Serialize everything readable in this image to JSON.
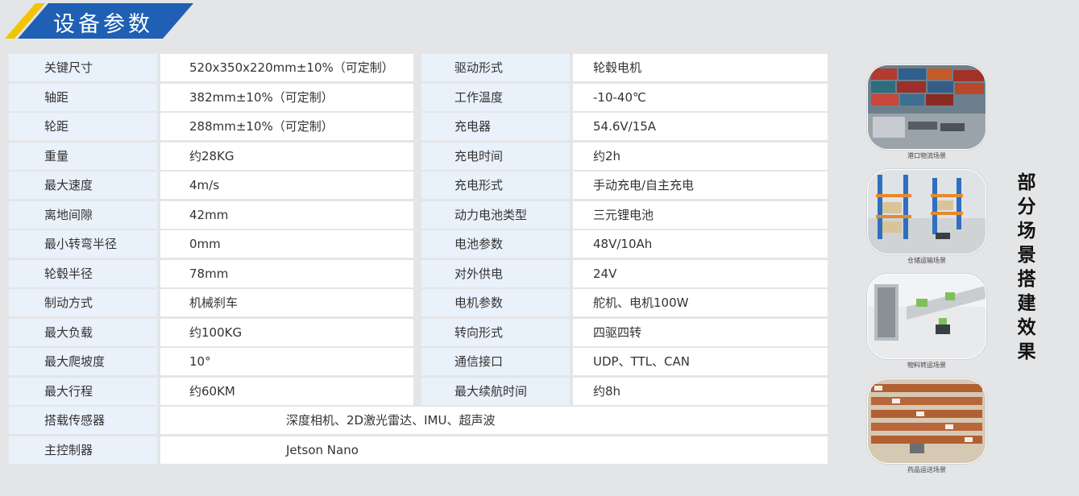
{
  "header": {
    "title": "设备参数"
  },
  "specs": [
    {
      "label1": "关键尺寸",
      "value1": "520x350x220mm±10%（可定制）",
      "label2": "驱动形式",
      "value2": "轮毂电机"
    },
    {
      "label1": "轴距",
      "value1": "382mm±10%（可定制）",
      "label2": "工作温度",
      "value2": "-10-40℃"
    },
    {
      "label1": "轮距",
      "value1": "288mm±10%（可定制）",
      "label2": "充电器",
      "value2": "54.6V/15A"
    },
    {
      "label1": "重量",
      "value1": "约28KG",
      "label2": "充电时间",
      "value2": "约2h"
    },
    {
      "label1": "最大速度",
      "value1": "4m/s",
      "label2": "充电形式",
      "value2": "手动充电/自主充电"
    },
    {
      "label1": "离地间隙",
      "value1": "42mm",
      "label2": "动力电池类型",
      "value2": "三元锂电池"
    },
    {
      "label1": "最小转弯半径",
      "value1": "0mm",
      "label2": "电池参数",
      "value2": "48V/10Ah"
    },
    {
      "label1": "轮毂半径",
      "value1": "78mm",
      "label2": "对外供电",
      "value2": "24V"
    },
    {
      "label1": "制动方式",
      "value1": "机械刹车",
      "label2": "电机参数",
      "value2": "舵机、电机100W"
    },
    {
      "label1": "最大负载",
      "value1": "约100KG",
      "label2": "转向形式",
      "value2": "四驱四转"
    },
    {
      "label1": "最大爬坡度",
      "value1": "10°",
      "label2": "通信接口",
      "value2": "UDP、TTL、CAN"
    },
    {
      "label1": "最大行程",
      "value1": "约60KM",
      "label2": "最大续航时间",
      "value2": "约8h"
    }
  ],
  "specs_wide": [
    {
      "label": "搭载传感器",
      "value": "深度相机、2D激光雷达、IMU、超声波"
    },
    {
      "label": "主控制器",
      "value": "Jetson Nano"
    }
  ],
  "scenes": [
    {
      "caption": "港口物流场景",
      "icon": "port-scene-image"
    },
    {
      "caption": "仓储运输场景",
      "icon": "warehouse-scene-image"
    },
    {
      "caption": "物料转运场景",
      "icon": "material-transfer-scene-image"
    },
    {
      "caption": "药品运送场景",
      "icon": "pharmacy-scene-image"
    }
  ],
  "side_title": "部分场景搭建效果",
  "colors": {
    "banner_blue": "#1f5fb4",
    "banner_yellow": "#f2c400",
    "label_bg": "#e9f1fa",
    "page_bg": "#e4e5e7"
  }
}
